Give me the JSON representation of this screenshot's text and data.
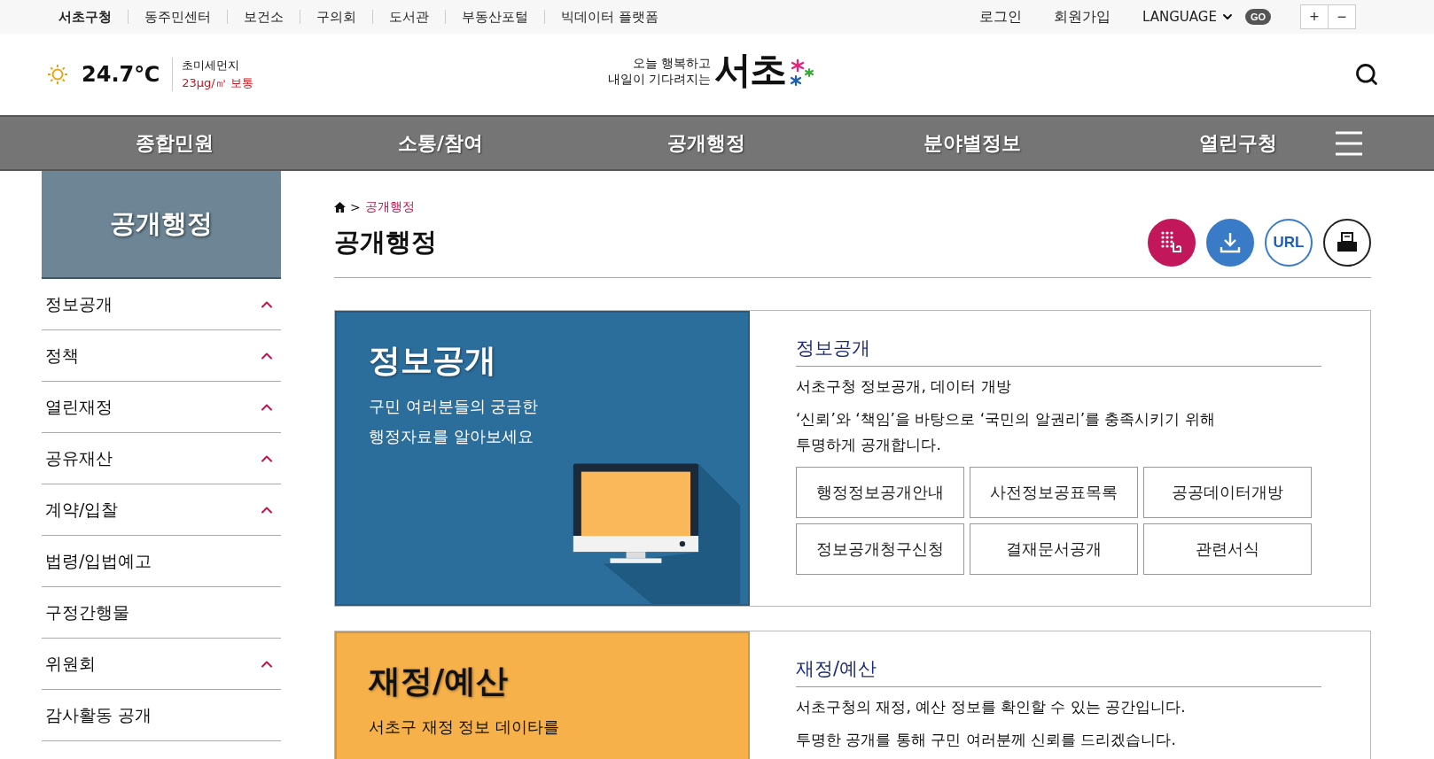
{
  "utility_bar": {
    "left_links": [
      {
        "label": "서초구청",
        "selected": true
      },
      {
        "label": "동주민센터",
        "selected": false
      },
      {
        "label": "보건소",
        "selected": false
      },
      {
        "label": "구의회",
        "selected": false
      },
      {
        "label": "도서관",
        "selected": false
      },
      {
        "label": "부동산포털",
        "selected": false
      },
      {
        "label": "빅데이터 플랫폼",
        "selected": false
      }
    ],
    "right_links": [
      "로그인",
      "회원가입"
    ],
    "language": {
      "label": "LANGUAGE",
      "button": "GO"
    },
    "zoom_buttons": [
      "+",
      "−"
    ]
  },
  "header": {
    "weather": {
      "temperature": "24.7℃",
      "dust_label": "초미세먼지",
      "dust_value": "23µg/㎥ 보통"
    },
    "logo": {
      "slogan": [
        "오늘 행복하고",
        "내일이 기다려지는"
      ],
      "name": "서초"
    }
  },
  "nav": {
    "items": [
      "종합민원",
      "소통/참여",
      "공개행정",
      "분야별정보",
      "열린구청"
    ]
  },
  "sidebar": {
    "title": "공개행정",
    "items": [
      {
        "label": "정보공개",
        "has_submenu": true
      },
      {
        "label": "정책",
        "has_submenu": true
      },
      {
        "label": "열린재정",
        "has_submenu": true
      },
      {
        "label": "공유재산",
        "has_submenu": true
      },
      {
        "label": "계약/입찰",
        "has_submenu": true
      },
      {
        "label": "법령/입법예고",
        "has_submenu": false
      },
      {
        "label": "구정간행물",
        "has_submenu": false
      },
      {
        "label": "위원회",
        "has_submenu": true
      },
      {
        "label": "감사활동 공개",
        "has_submenu": false
      }
    ]
  },
  "page": {
    "breadcrumb_separator": ">",
    "breadcrumb": "공개행정",
    "title": "공개행정",
    "tools": [
      {
        "kind": "sign"
      },
      {
        "kind": "download"
      },
      {
        "kind": "url",
        "label": "URL"
      },
      {
        "kind": "print"
      }
    ]
  },
  "sections": [
    {
      "kind": "info",
      "color": "#2b6d9b",
      "title": "정보공개",
      "tagline": [
        "구민 여러분들의 궁금한",
        "행정자료를 알아보세요"
      ],
      "heading": "정보공개",
      "paragraphs": [
        "서초구청 정보공개, 데이터 개방",
        "‘신뢰’와 ‘책임’을 바탕으로 ‘국민의 알권리’를 충족시키기 위해 투명하게 공개합니다."
      ],
      "links": [
        "행정정보공개안내",
        "사전정보공표목록",
        "공공데이터개방",
        "정보공개청구신청",
        "결재문서공개",
        "관련서식"
      ]
    },
    {
      "kind": "budget",
      "color": "#f6b14a",
      "title": "재정/예산",
      "tagline": [
        "서초구 재정 정보 데이타를"
      ],
      "heading": "재정/예산",
      "paragraphs": [
        "서초구청의 재정, 예산 정보를 확인할 수 있는 공간입니다.",
        "투명한 공개를 통해 구민 여러분께 신뢰를 드리겠습니다."
      ]
    }
  ]
}
